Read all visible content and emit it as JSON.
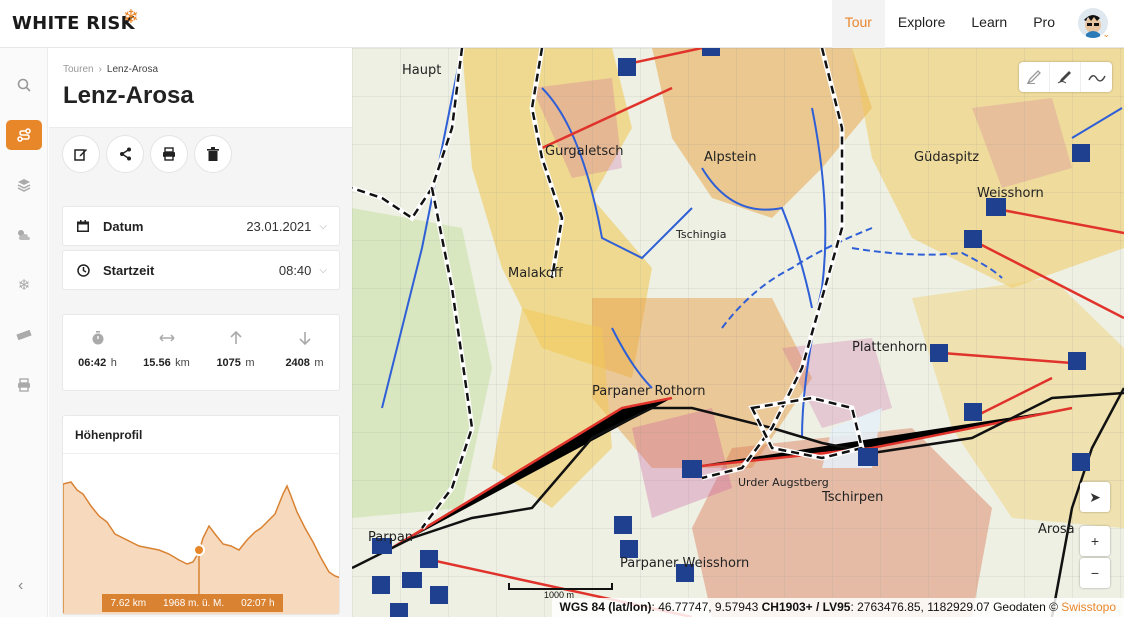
{
  "brand": {
    "name": "WHITE RISK",
    "accent": "#e8862a"
  },
  "nav": [
    {
      "label": "Tour",
      "active": true
    },
    {
      "label": "Explore"
    },
    {
      "label": "Learn"
    },
    {
      "label": "Pro"
    }
  ],
  "rail": [
    "search-icon",
    "tour-icon",
    "layers-icon",
    "weather-icon",
    "snowflake-icon",
    "ruler-icon",
    "print-icon"
  ],
  "breadcrumb": {
    "parent": "Touren",
    "current": "Lenz-Arosa"
  },
  "title": "Lenz-Arosa",
  "fields": {
    "date": {
      "label": "Datum",
      "value": "23.01.2021"
    },
    "start": {
      "label": "Startzeit",
      "value": "08:40"
    }
  },
  "stats": {
    "duration": {
      "value": "06:42",
      "unit": "h"
    },
    "distance": {
      "value": "15.56",
      "unit": "km"
    },
    "ascent": {
      "value": "1075",
      "unit": "m"
    },
    "descent": {
      "value": "2408",
      "unit": "m"
    }
  },
  "profile": {
    "title": "Höhenprofil",
    "distance": "7.62 km",
    "altitude": "1968 m. ü. M.",
    "time": "02:07 h"
  },
  "map": {
    "scale": "1000 m",
    "coords": {
      "wgs_label": "WGS 84 (lat/lon)",
      "wgs_value": ": 46.77747, 9.57943",
      "ch_label": "CH1903+ / LV95",
      "ch_value": ": 2763476.85, 1182929.07",
      "geo": "Geodaten ©",
      "source": "Swisstopo"
    },
    "zoom_in": "+",
    "zoom_out": "−",
    "labels": {
      "haupt": "Haupt",
      "gurgaletsch": "Gurgaletsch",
      "alpstein": "Alpstein",
      "gudaspitz": "Güdaspitz",
      "weisshorn": "Weisshorn",
      "tschiggia": "Tschingia",
      "malakoff": "Malakoff",
      "plattenhorn": "Plattenhorn",
      "parpaner": "Parpaner Rothorn",
      "tschirpen": "Tschirpen",
      "parpan": "Parpan",
      "parpaner_w": "Parpaner Weisshorn",
      "urdenfurgga": "Urder Augstberg",
      "arosa": "Arosa"
    }
  }
}
